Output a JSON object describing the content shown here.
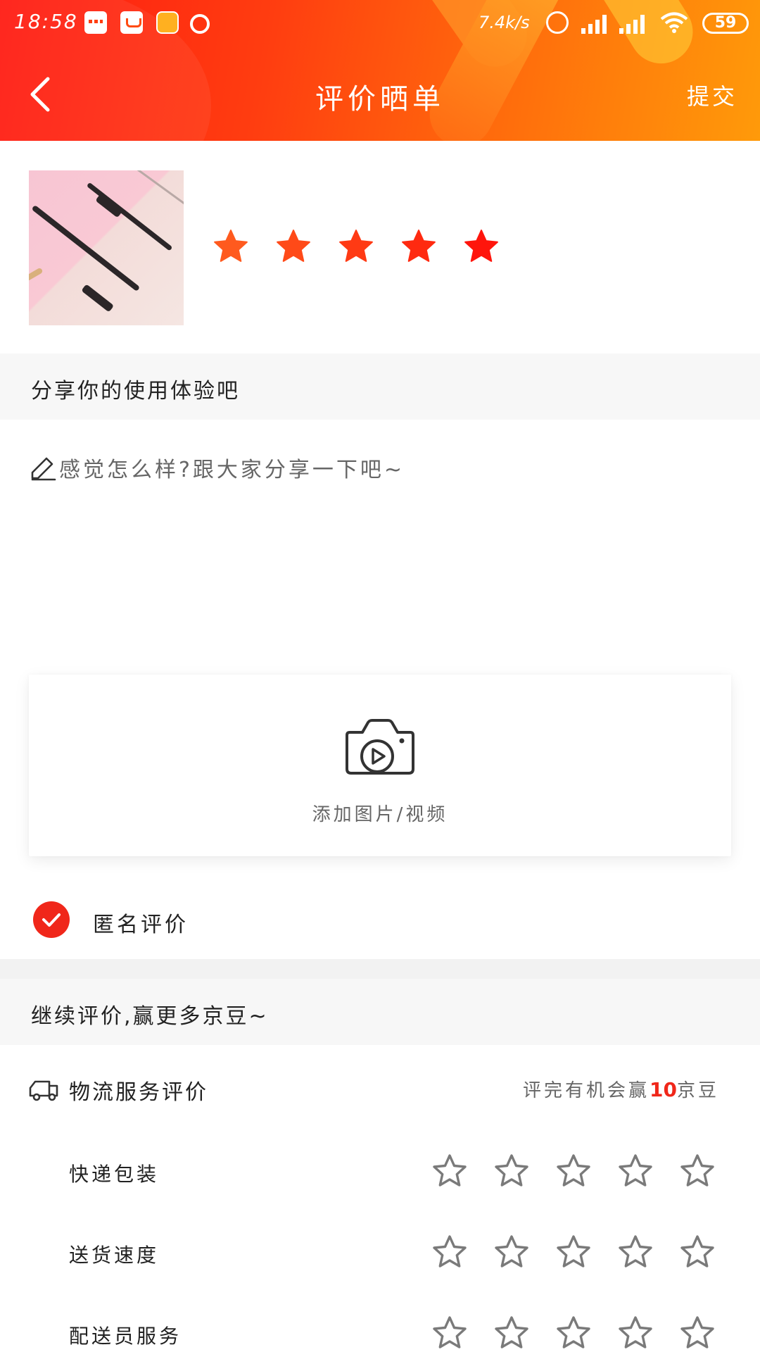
{
  "status_bar": {
    "time": "18:58",
    "net_speed": "7.4k/s",
    "battery": "59",
    "icons": [
      "message-icon",
      "tv-icon",
      "app-icon",
      "alarm-app-icon",
      "clock-icon",
      "signal-icon",
      "signal-icon",
      "wifi-icon",
      "battery-icon"
    ]
  },
  "nav": {
    "title": "评价晒单",
    "submit_label": "提交"
  },
  "product": {
    "rating": 5,
    "max_rating": 5,
    "star_colors": [
      "#ff5a1e",
      "#ff4a18",
      "#ff3a14",
      "#ff2a10",
      "#ff150c"
    ]
  },
  "share_section": {
    "title": "分享你的使用体验吧"
  },
  "review": {
    "value": "",
    "placeholder": "感觉怎么样?跟大家分享一下吧~"
  },
  "media": {
    "add_label": "添加图片/视频"
  },
  "anonymous": {
    "label": "匿名评价",
    "checked": true
  },
  "continue_section": {
    "title": "继续评价,赢更多京豆~"
  },
  "logistics": {
    "title": "物流服务评价",
    "reward_prefix": "评完有机会赢",
    "reward_amount": "10",
    "reward_suffix": "京豆",
    "rows": [
      {
        "label": "快递包装",
        "rating": 0
      },
      {
        "label": "送货速度",
        "rating": 0
      },
      {
        "label": "配送员服务",
        "rating": 0
      }
    ]
  },
  "colors": {
    "accent": "#f0271a",
    "header_start": "#ff1a12",
    "header_end": "#ff9a0a"
  }
}
